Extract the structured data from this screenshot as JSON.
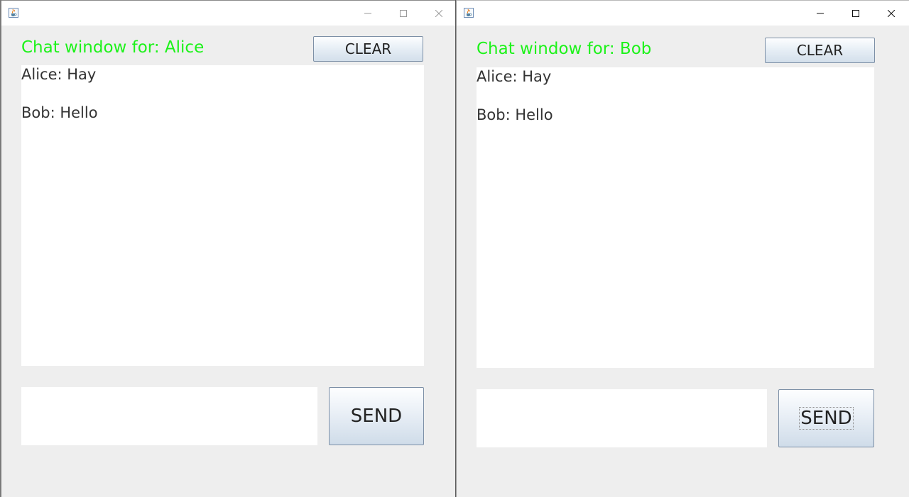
{
  "windows": [
    {
      "id": "alice",
      "title_label": "Chat window for: Alice",
      "clear_label": "CLEAR",
      "messages": [
        "Alice: Hay",
        "Bob: Hello"
      ],
      "input_value": "",
      "send_label": "SEND"
    },
    {
      "id": "bob",
      "title_label": "Chat window for: Bob",
      "clear_label": "CLEAR",
      "messages": [
        "Alice: Hay",
        "Bob: Hello"
      ],
      "input_value": "",
      "send_label": "SEND"
    }
  ],
  "colors": {
    "title_green": "#1df21a",
    "window_bg": "#eeeeee",
    "button_border": "#7c8fa6"
  },
  "icons": {
    "app": "java-coffee-cup-icon",
    "minimize": "minimize-icon",
    "maximize": "maximize-icon",
    "close": "close-icon"
  }
}
